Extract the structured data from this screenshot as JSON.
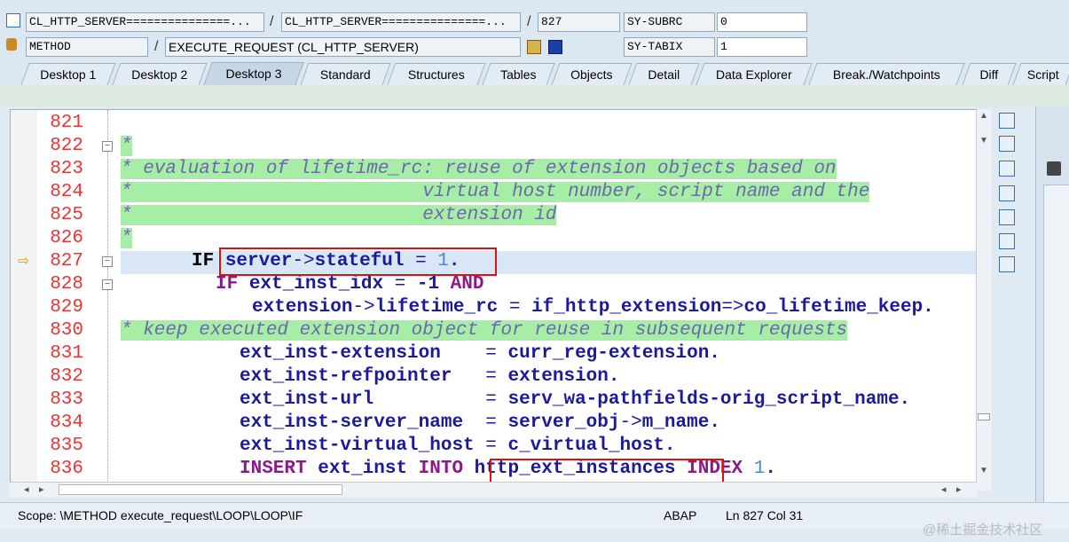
{
  "header": {
    "row1": {
      "obj1": "CL_HTTP_SERVER===============...",
      "sep1": "/",
      "obj2": "CL_HTTP_SERVER===============...",
      "sep2": "/",
      "line": "827",
      "sysvar": "SY-SUBRC",
      "sysval": "0"
    },
    "row2": {
      "type": "METHOD",
      "sep1": "/",
      "name": "EXECUTE_REQUEST (CL_HTTP_SERVER)",
      "sysvar": "SY-TABIX",
      "sysval": "1"
    }
  },
  "tabs": [
    "Desktop 1",
    "Desktop 2",
    "Desktop 3",
    "Standard",
    "Structures",
    "Tables",
    "Objects",
    "Detail",
    "Data Explorer",
    "Break./Watchpoints",
    "Diff",
    "Script"
  ],
  "active_tab": "Desktop 3",
  "code": [
    {
      "n": "821",
      "t": ""
    },
    {
      "n": "822",
      "t": "*"
    },
    {
      "n": "823",
      "t": "* evaluation of lifetime_rc: reuse of extension objects based on"
    },
    {
      "n": "824",
      "t": "*                          virtual host number, script name and the"
    },
    {
      "n": "825",
      "t": "*                          extension id"
    },
    {
      "n": "826",
      "t": "*"
    },
    {
      "n": "827",
      "t": "IF server->stateful = 1."
    },
    {
      "n": "828",
      "t": "IF ext_inst_idx = -1 AND"
    },
    {
      "n": "829",
      "t": "extension->lifetime_rc = if_http_extension=>co_lifetime_keep."
    },
    {
      "n": "830",
      "t": "* keep executed extension object for reuse in subsequent requests"
    },
    {
      "n": "831",
      "t": "ext_inst-extension    = curr_reg-extension."
    },
    {
      "n": "832",
      "t": "ext_inst-refpointer   = extension."
    },
    {
      "n": "833",
      "t": "ext_inst-url          = serv_wa-pathfields-orig_script_name."
    },
    {
      "n": "834",
      "t": "ext_inst-server_name  = server_obj->m_name."
    },
    {
      "n": "835",
      "t": "ext_inst-virtual_host = c_virtual_host."
    },
    {
      "n": "836",
      "t": "INSERT ext_inst INTO http_ext_instances INDEX 1."
    }
  ],
  "status": {
    "scope": "Scope: \\METHOD execute_request\\LOOP\\LOOP\\IF",
    "lang": "ABAP",
    "position": "Ln 827 Col  31"
  },
  "watermark": "@稀土掘金技术社区"
}
